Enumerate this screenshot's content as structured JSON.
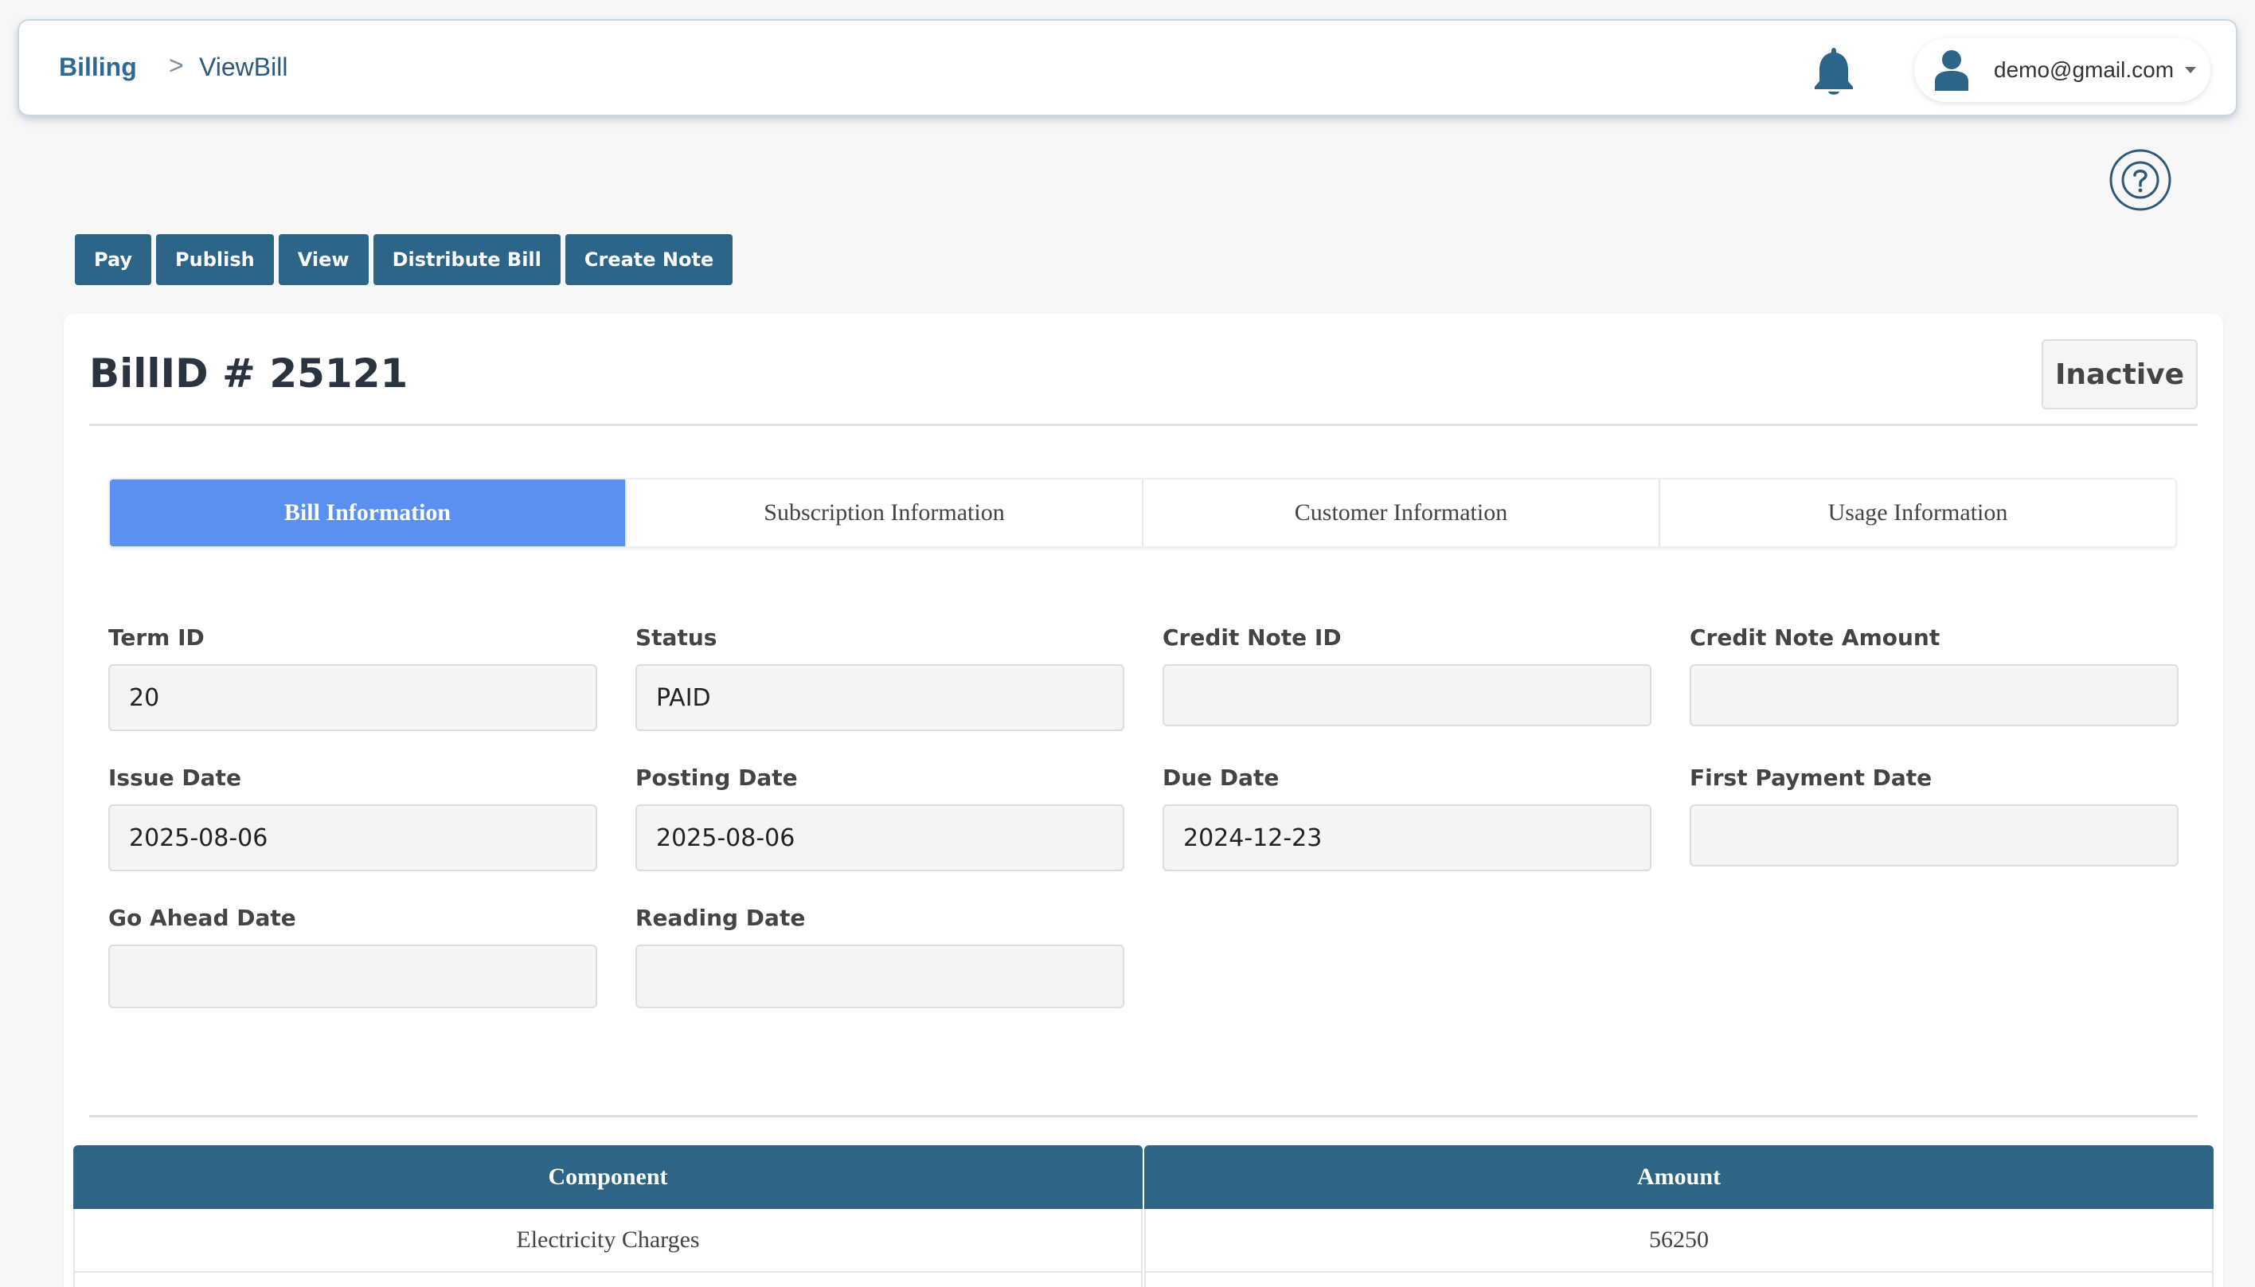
{
  "breadcrumb": {
    "root": "Billing",
    "separator": ">",
    "current": "ViewBill"
  },
  "user": {
    "email": "demo@gmail.com"
  },
  "actions": [
    "Pay",
    "Publish",
    "View",
    "Distribute Bill",
    "Create Note"
  ],
  "bill": {
    "title": "BillID # 25121",
    "status_badge": "Inactive"
  },
  "tabs": [
    "Bill Information",
    "Subscription Information",
    "Customer Information",
    "Usage Information"
  ],
  "fields": {
    "term_id": {
      "label": "Term ID",
      "value": "20"
    },
    "status": {
      "label": "Status",
      "value": "PAID"
    },
    "credit_note_id": {
      "label": "Credit Note ID",
      "value": ""
    },
    "credit_note_amount": {
      "label": "Credit Note Amount",
      "value": ""
    },
    "issue_date": {
      "label": "Issue Date",
      "value": "2025-08-06"
    },
    "posting_date": {
      "label": "Posting Date",
      "value": "2025-08-06"
    },
    "due_date": {
      "label": "Due Date",
      "value": "2024-12-23"
    },
    "first_payment_date": {
      "label": "First Payment Date",
      "value": ""
    },
    "go_ahead_date": {
      "label": "Go Ahead Date",
      "value": ""
    },
    "reading_date": {
      "label": "Reading Date",
      "value": ""
    }
  },
  "table": {
    "headers": [
      "Component",
      "Amount"
    ],
    "rows": [
      [
        "Electricity Charges",
        "56250"
      ]
    ]
  },
  "colors": {
    "primary": "#2d6589",
    "active_tab": "#5b90f0",
    "background": "#f7f7f7"
  }
}
